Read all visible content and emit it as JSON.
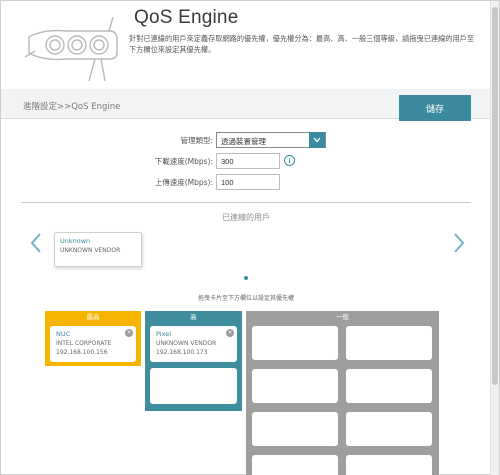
{
  "header": {
    "title": "QoS Engine",
    "description": "針對已連線的用戶來定義存取網路的優先權，優先權分為：最高、高、一般三個等級，請拖曳已連線的用戶至下方欄位來設定其優先權。"
  },
  "toolbar": {
    "breadcrumb": "進階設定>>QoS Engine",
    "save_label": "儲存"
  },
  "form": {
    "management_type_label": "管理類型:",
    "management_type_value": "透過裝置管理",
    "download_label": "下載速度(Mbps):",
    "download_value": "300",
    "upload_label": "上傳速度(Mbps):",
    "upload_value": "100"
  },
  "connected_clients": {
    "title": "已連線的用戶",
    "devices": [
      {
        "name": "Unknown",
        "vendor": "UNKNOWN VENDOR"
      }
    ],
    "hint": "拖曳卡片至下方欄位以設定其優先權"
  },
  "priority": {
    "highest": {
      "label": "最高",
      "devices": [
        {
          "name": "NUC",
          "vendor": "INTEL CORPORATE",
          "ip": "192.168.100.156"
        }
      ]
    },
    "high": {
      "label": "高",
      "devices": [
        {
          "name": "Pixel",
          "vendor": "UNKNOWN VENDOR",
          "ip": "192.168.100.173"
        }
      ]
    },
    "general": {
      "label": "一般",
      "devices": []
    }
  },
  "colors": {
    "accent": "#3b8aa0",
    "highest": "#f5b400",
    "high": "#3f8ea0",
    "general": "#9e9e9e"
  },
  "icons": {
    "select_arrow": "chevron-down-icon",
    "info": "info-icon",
    "left_arrow": "chevron-left-icon",
    "right_arrow": "chevron-right-icon",
    "remove": "close-icon"
  }
}
